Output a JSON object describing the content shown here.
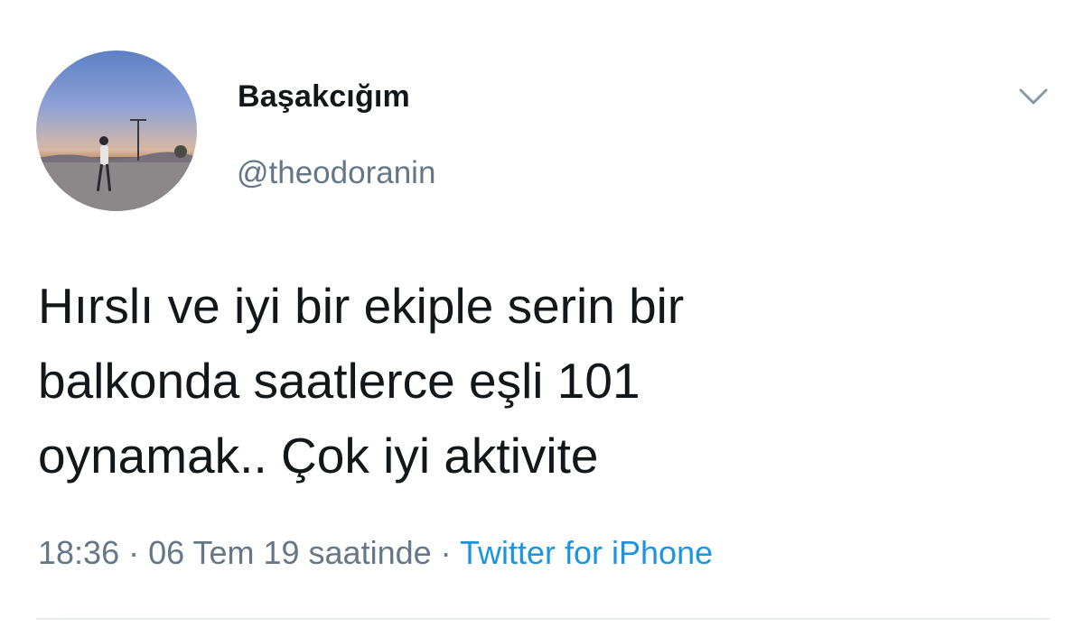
{
  "user": {
    "display_name": "Başakcığım",
    "handle": "@theodoranin",
    "avatar": "profile-photo"
  },
  "menu_icon": "chevron-down-icon",
  "tweet": {
    "text": "Hırslı ve iyi bir ekiple serin bir\nbalkonda saatlerce eşli 101\noynamak.. Çok iyi aktivite"
  },
  "meta": {
    "timestamp": "18:36 · 06 Tem 19 saatinde",
    "separator": " · ",
    "source": "Twitter for iPhone"
  },
  "colors": {
    "text": "#14171a",
    "secondary": "#657786",
    "link": "#1b95e0",
    "divider": "#e6ecf0"
  }
}
